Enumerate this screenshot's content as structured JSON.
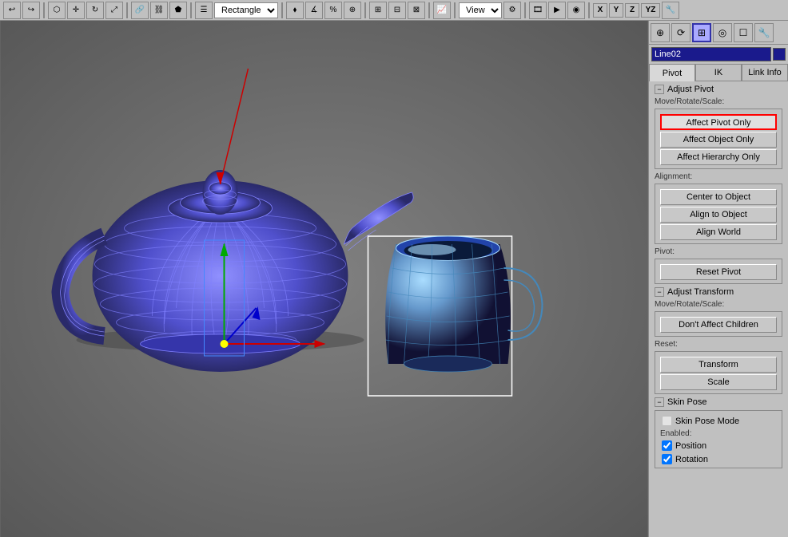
{
  "toolbar": {
    "view_label": "View",
    "axes": [
      "X",
      "Y",
      "Z",
      "YZ"
    ]
  },
  "panel": {
    "name_value": "Line02",
    "color_swatch": "#1a1a8c",
    "tabs": [
      {
        "label": "Pivot",
        "active": true
      },
      {
        "label": "IK",
        "active": false
      },
      {
        "label": "Link Info",
        "active": false
      }
    ],
    "adjust_pivot_title": "Adjust Pivot",
    "move_rotate_scale_label": "Move/Rotate/Scale:",
    "affect_pivot_only": "Affect Pivot Only",
    "affect_object_only": "Affect Object Only",
    "affect_hierarchy_only": "Affect Hierarchy Only",
    "alignment_label": "Alignment:",
    "center_to_object": "Center to Object",
    "align_to_object": "Align to Object",
    "align_world": "Align World",
    "pivot_label": "Pivot:",
    "reset_pivot": "Reset Pivot",
    "adjust_transform_title": "Adjust Transform",
    "move_rotate_scale_label2": "Move/Rotate/Scale:",
    "dont_affect_children": "Don't Affect Children",
    "reset_label": "Reset:",
    "transform_btn": "Transform",
    "scale_btn": "Scale",
    "skin_pose_title": "Skin Pose",
    "skin_pose_mode": "Skin Pose Mode",
    "enabled_label": "Enabled:",
    "position_label": "Position",
    "rotation_label": "Rotation"
  },
  "viewport": {
    "label": ""
  }
}
